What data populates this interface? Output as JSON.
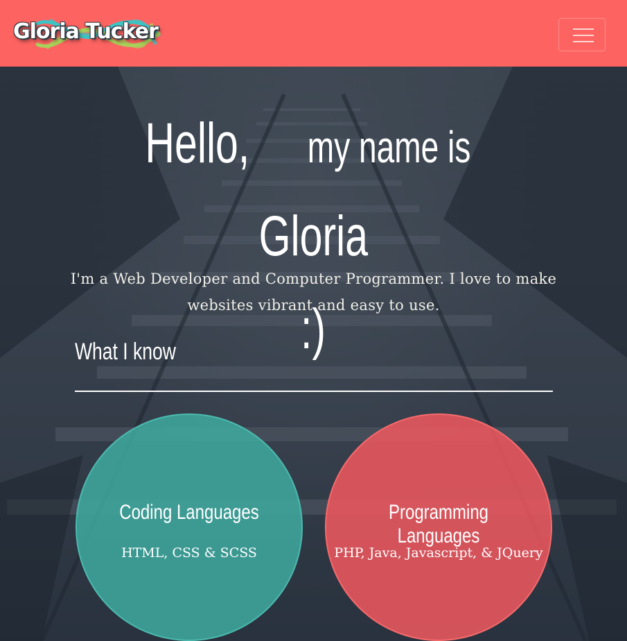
{
  "brand": {
    "logo_text": "Gloria Tucker",
    "colors": {
      "header": "#fd6461",
      "teal": "#3faaa0",
      "coral": "#f05860",
      "logo_teal": "#3cc4c4",
      "logo_green": "#a8d25a"
    }
  },
  "header": {
    "menu_icon": "hamburger-menu-icon"
  },
  "hero": {
    "greeting_hello": "Hello,",
    "greeting_middle": "my name is",
    "greeting_name": "Gloria",
    "greeting_smiley": ":)",
    "tagline": "I'm a Web Developer and Computer Programmer. I love to make websites vibrant and easy to use."
  },
  "skills": {
    "title": "What I know",
    "items": [
      {
        "title": "Coding Languages",
        "list": "HTML, CSS & SCSS"
      },
      {
        "title": "Programming Languages",
        "list": "PHP, Java, Javascript, & JQuery"
      }
    ]
  }
}
